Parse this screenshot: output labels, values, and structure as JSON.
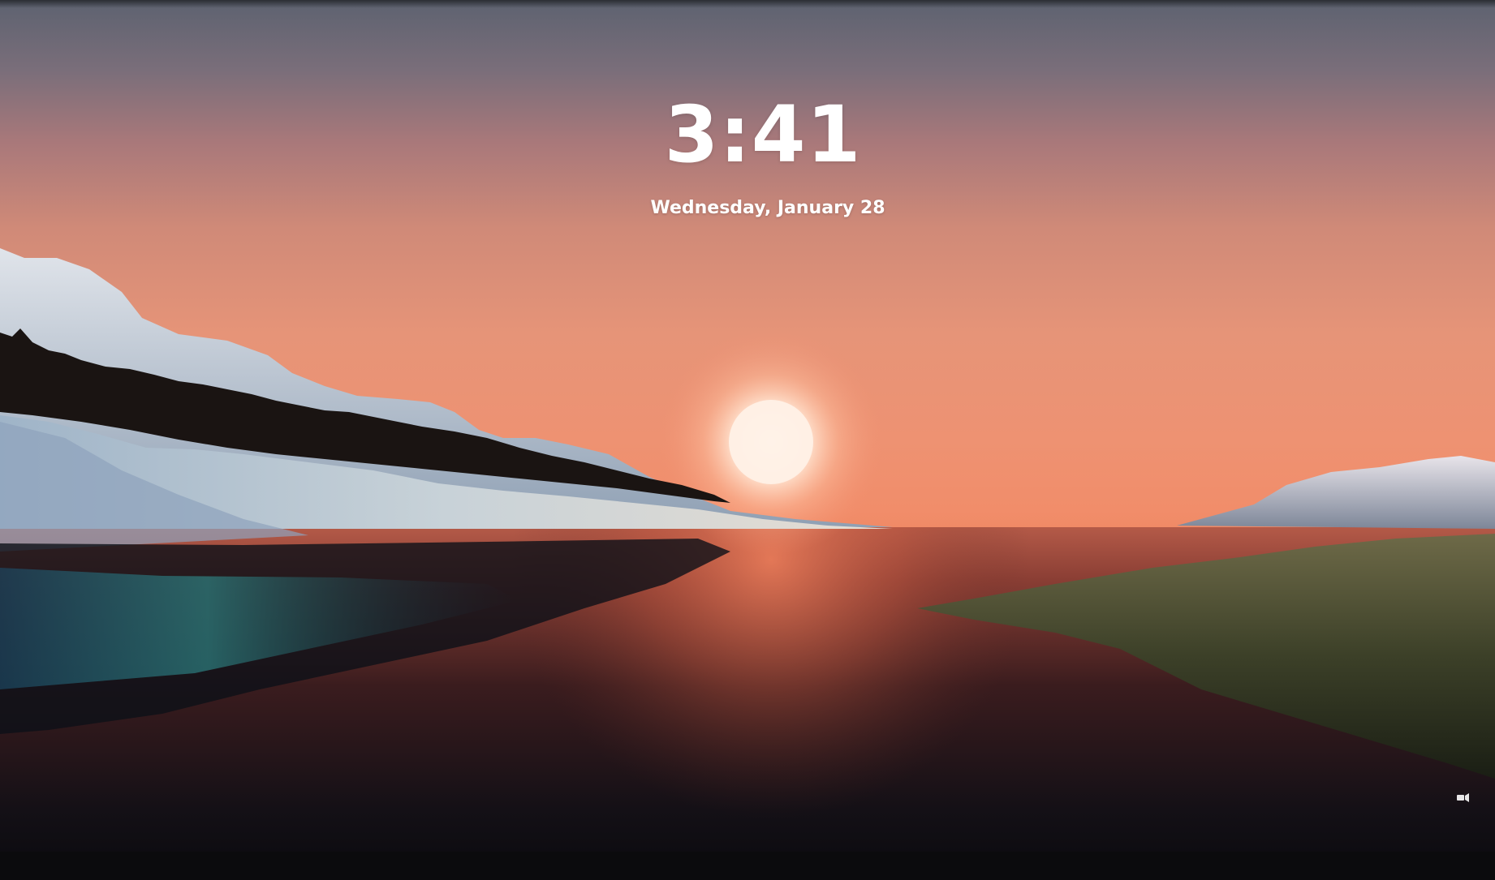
{
  "lockscreen": {
    "time": "3:41",
    "date": "Wednesday, January 28"
  },
  "status_icons": [
    {
      "name": "network-icon"
    }
  ]
}
